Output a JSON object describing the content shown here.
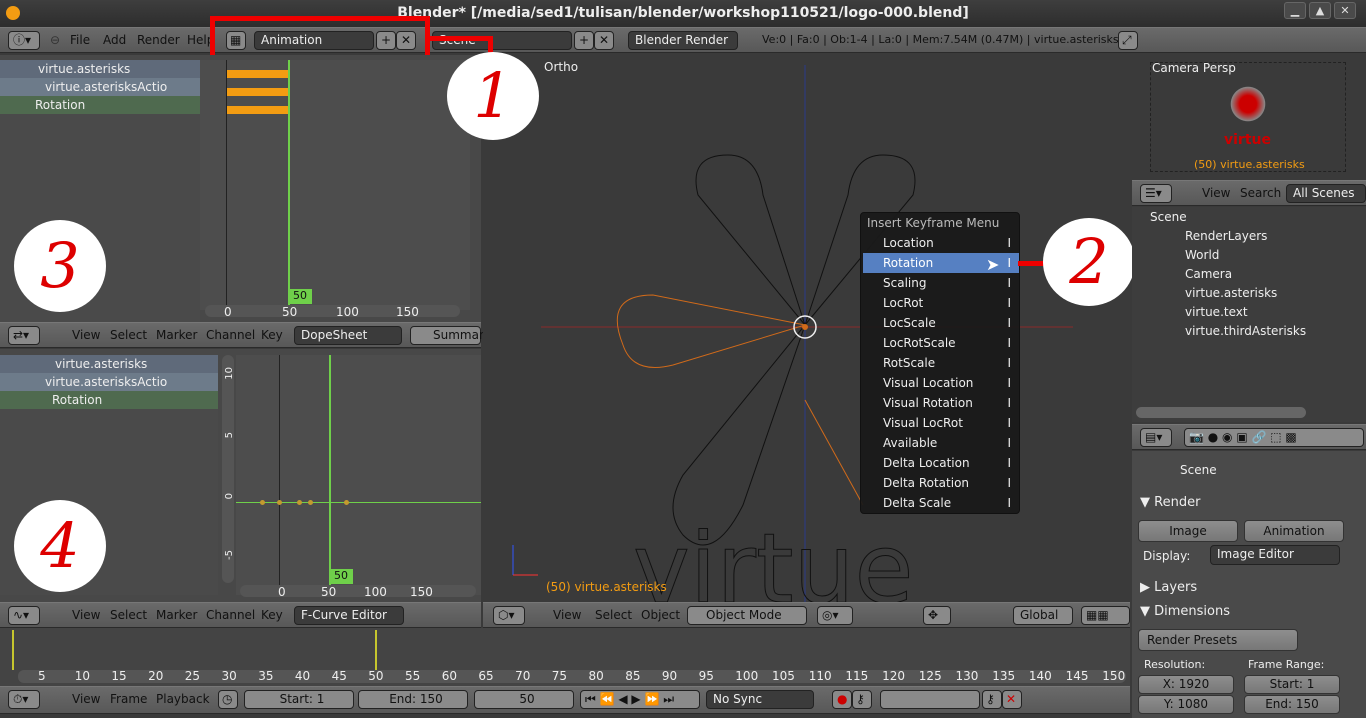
{
  "window": {
    "title": "Blender* [/media/sed1/tulisan/blender/workshop110521/logo-000.blend]"
  },
  "infoheader": {
    "menus": [
      "File",
      "Add",
      "Render",
      "Help"
    ],
    "screen_layout": "Animation",
    "scene": "Scene",
    "engine": "Blender Render",
    "stats": "Ve:0 | Fa:0 | Ob:1-4 | La:0 | Mem:7.54M (0.47M) | virtue.asterisks"
  },
  "dopesheet": {
    "channels": [
      "virtue.asterisks",
      "virtue.asterisksActio",
      "Rotation"
    ],
    "ticks": [
      "0",
      "50",
      "100",
      "150"
    ],
    "frame": "50",
    "menus": [
      "View",
      "Select",
      "Marker",
      "Channel",
      "Key"
    ],
    "mode": "DopeSheet",
    "summary": "Summary"
  },
  "graph": {
    "channels": [
      "virtue.asterisks",
      "virtue.asterisksActio",
      "Rotation"
    ],
    "yticks": [
      "10",
      "5",
      "0",
      "-5"
    ],
    "ticks": [
      "0",
      "50",
      "100",
      "150"
    ],
    "frame": "50",
    "menus": [
      "View",
      "Select",
      "Marker",
      "Channel",
      "Key"
    ],
    "mode": "F-Curve Editor"
  },
  "view3d": {
    "label": "Ortho",
    "object": "(50) virtue.asterisks",
    "menus": [
      "View",
      "Select",
      "Object"
    ],
    "mode": "Object Mode",
    "orientation": "Global"
  },
  "keyframe_menu": {
    "title": "Insert Keyframe Menu",
    "items": [
      "Location",
      "Rotation",
      "Scaling",
      "LocRot",
      "LocScale",
      "LocRotScale",
      "RotScale",
      "Visual Location",
      "Visual Rotation",
      "Visual LocRot",
      "Available",
      "Delta Location",
      "Delta Rotation",
      "Delta Scale"
    ],
    "hotkey": "I",
    "selected": "Rotation"
  },
  "camera_view": {
    "label": "Camera Persp",
    "logo_text": "virtue",
    "object": "(50) virtue.asterisks"
  },
  "outliner": {
    "menus": [
      "View",
      "Search"
    ],
    "filter": "All Scenes",
    "rows": [
      "Scene",
      "RenderLayers",
      "World",
      "Camera",
      "virtue.asterisks",
      "virtue.text",
      "virtue.thirdAsterisks"
    ]
  },
  "properties": {
    "scene": "Scene",
    "render_header": "Render",
    "image_btn": "Image",
    "anim_btn": "Animation",
    "display_label": "Display:",
    "display_value": "Image Editor",
    "layers": "Layers",
    "dimensions": "Dimensions",
    "presets": "Render Presets",
    "resolution_label": "Resolution:",
    "frame_range_label": "Frame Range:",
    "res_x": "X: 1920",
    "res_y": "Y: 1080",
    "start": "Start: 1",
    "end": "End: 150"
  },
  "timeline": {
    "ticks": [
      "5",
      "10",
      "15",
      "20",
      "25",
      "30",
      "35",
      "40",
      "45",
      "50",
      "55",
      "60",
      "65",
      "70",
      "75",
      "80",
      "85",
      "90",
      "95",
      "100",
      "105",
      "110",
      "115",
      "120",
      "125",
      "130",
      "135",
      "140",
      "145",
      "150"
    ],
    "menus": [
      "View",
      "Frame",
      "Playback"
    ],
    "start": "Start: 1",
    "end": "End: 150",
    "current": "50",
    "sync": "No Sync"
  },
  "annotations": [
    "1",
    "2",
    "3",
    "4"
  ],
  "colors": {
    "accent": "#5680c2",
    "keyframe": "#f39c12",
    "current_frame": "#6fd04a",
    "annotation": "#d00000"
  }
}
